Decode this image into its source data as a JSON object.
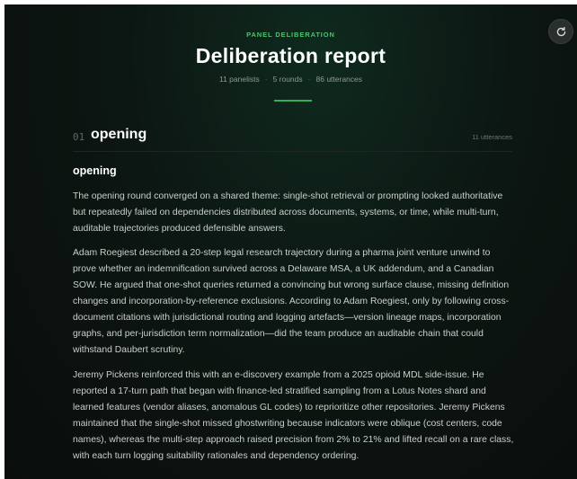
{
  "header": {
    "eyebrow": "PANEL DELIBERATION",
    "title": "Deliberation report",
    "meta": {
      "panelists": "11 panelists",
      "rounds": "5 rounds",
      "utterances": "86 utterances"
    }
  },
  "toolbar": {
    "refresh_icon": "refresh-icon"
  },
  "section": {
    "number": "01",
    "name": "opening",
    "count": "11 utterances",
    "subtitle": "opening",
    "paragraphs": [
      "The opening round converged on a shared theme: single-shot retrieval or prompting looked authoritative but repeatedly failed on dependencies distributed across documents, systems, or time, while multi-turn, auditable trajectories produced defensible answers.",
      "Adam Roegiest described a 20-step legal research trajectory during a pharma joint venture unwind to prove whether an indemnification survived across a Delaware MSA, a UK addendum, and a Canadian SOW. He argued that one-shot queries returned a convincing but wrong surface clause, missing definition changes and incorporation-by-reference exclusions. According to Adam Roegiest, only by following cross-document citations with jurisdictional routing and logging artefacts—version lineage maps, incorporation graphs, and per-jurisdiction term normalization—did the team produce an auditable chain that could withstand Daubert scrutiny.",
      "Jeremy Pickens reinforced this with an e-discovery example from a 2025 opioid MDL side-issue. He reported a 17-turn path that began with finance-led stratified sampling from a Lotus Notes shard and learned features (vendor aliases, anomalous GL codes) to reprioritize other repositories. Jeremy Pickens maintained that the single-shot missed ghostwriting because indicators were oblique (cost centers, code names), whereas the multi-step approach raised precision from 2% to 21% and lifted recall on a rare class, with each turn logging suitability rationales and dependency ordering."
    ]
  }
}
